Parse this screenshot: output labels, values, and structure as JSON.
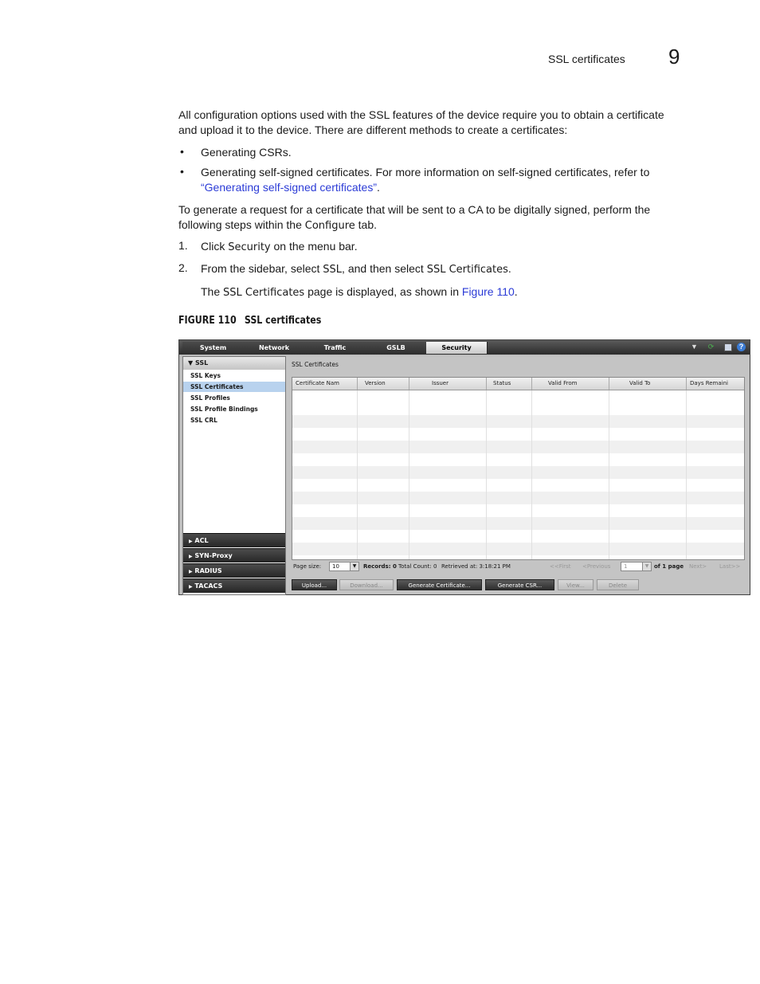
{
  "header": {
    "section_title": "SSL certificates",
    "chapter_number": "9"
  },
  "body": {
    "intro_line1": "All configuration options used with the SSL features of the device require you to obtain a certificate",
    "intro_line2": "and upload it to the device. There are different methods to create a certificates:",
    "bullet1": "Generating CSRs.",
    "bullet2_line1": "Generating self-signed certificates. For more information on self-signed certificates, refer to",
    "bullet2_link": "“Generating self-signed certificates”",
    "bullet2_end": ".",
    "para2_line1": "To generate a request for a certificate that will be sent to a CA to be digitally signed, perform the",
    "para2_line2_pre": "following steps within the ",
    "para2_term": "Configure",
    "para2_line2_post": " tab.",
    "steps": [
      {
        "num": "1.",
        "pre": "Click ",
        "term": "Security",
        "post": " on the menu bar."
      },
      {
        "num": "2.",
        "pre": "From the sidebar, select ",
        "term": "SSL",
        "mid": ", and then select ",
        "term2": "SSL Certificates",
        "post": "."
      }
    ],
    "result_pre": "The ",
    "result_term": "SSL Certificates",
    "result_mid": " page is displayed, as shown in ",
    "result_link": "Figure 110",
    "result_post": "."
  },
  "figure": {
    "label": "FIGURE 110",
    "title": "SSL certificates"
  },
  "app": {
    "tabs": [
      "System",
      "Network",
      "Traffic",
      "GSLB",
      "Security"
    ],
    "active_tab": "Security",
    "icons": [
      "pin-icon",
      "refresh-icon",
      "save-icon",
      "help-icon"
    ],
    "sidebar": {
      "header": "SSL",
      "items": [
        "SSL Keys",
        "SSL Certificates",
        "SSL Profiles",
        "SSL Profile Bindings",
        "SSL CRL"
      ],
      "selected": "SSL Certificates",
      "sections": [
        "ACL",
        "SYN-Proxy",
        "RADIUS",
        "TACACS"
      ]
    },
    "main": {
      "title": "SSL Certificates",
      "columns": [
        "Certificate Nam",
        "Version",
        "Issuer",
        "Status",
        "Valid From",
        "Valid To",
        "Days Remaini"
      ],
      "pager": {
        "page_size_label": "Page size:",
        "page_size": "10",
        "records": "Records: 0",
        "total": "Total Count: 0",
        "retrieved": "Retrieved at: 3:18:21 PM",
        "first": "<<First",
        "previous": "<Previous",
        "page": "1",
        "of_pages": "of 1 page",
        "next": "Next>",
        "last": "Last>>"
      },
      "actions": [
        "Upload...",
        "Download...",
        "Generate Certificate...",
        "Generate CSR...",
        "View...",
        "Delete"
      ]
    }
  }
}
